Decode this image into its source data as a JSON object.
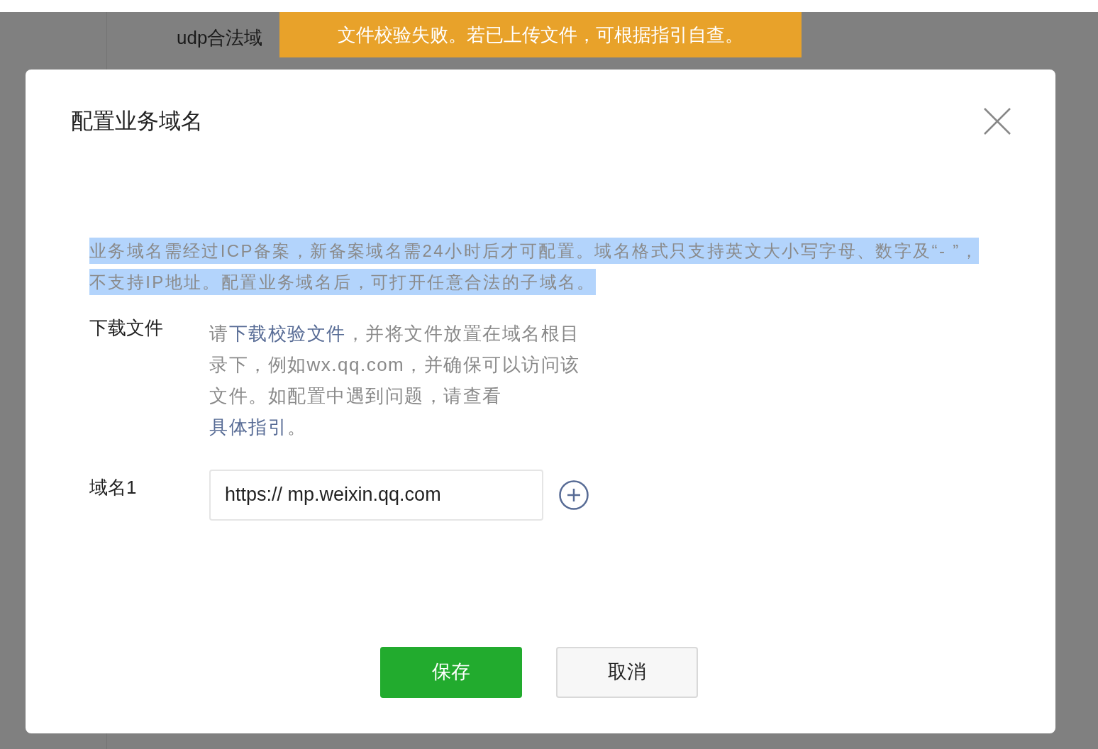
{
  "background": {
    "label": "udp合法域"
  },
  "toast": {
    "text": "文件校验失败。若已上传文件，可根据指引自查。"
  },
  "dialog": {
    "title": "配置业务域名",
    "notice": {
      "text": "业务域名需经过ICP备案，新备案域名需24小时后才可配置。域名格式只支持英文大小写字母、数字及“- ”，不支持IP地址。配置业务域名后，可打开任意合法的子域名。",
      "highlighted": true
    },
    "download": {
      "label": "下载文件",
      "parts": [
        {
          "kind": "text",
          "text": "请"
        },
        {
          "kind": "link",
          "text": "下载校验文件"
        },
        {
          "kind": "text",
          "text": "，并将文件放置在域名根目录下，例如wx.qq.com，并确保可以访问该文件。如配置中遇到问题，请查看"
        },
        {
          "kind": "link",
          "text": "具体指引"
        },
        {
          "kind": "text",
          "text": "。"
        }
      ]
    },
    "domains": [
      {
        "label": "域名1",
        "value": "https:// mp.weixin.qq.com"
      }
    ],
    "buttons": [
      {
        "label": "保存",
        "kind": "primary"
      },
      {
        "label": "取消",
        "kind": "secondary"
      }
    ]
  }
}
